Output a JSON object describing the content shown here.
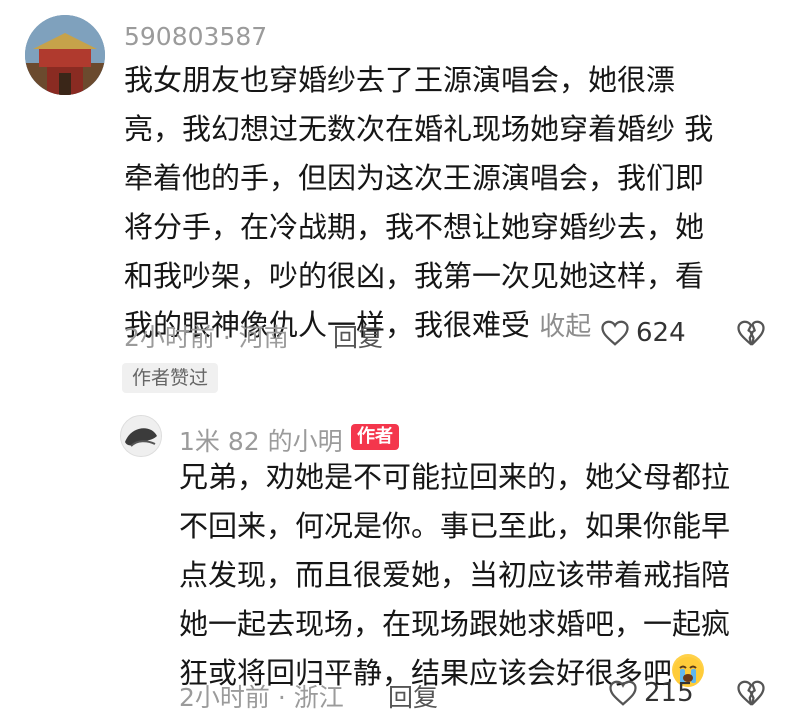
{
  "comment": {
    "username": "590803587",
    "lines": [
      "我女朋友也穿婚纱去了王源演唱会，她很漂",
      "亮，我幻想过无数次在婚礼现场她穿着婚纱 我",
      "牵着他的手，但因为这次王源演唱会，我们即",
      "将分手，在冷战期，我不想让她穿婚纱去，她",
      "和我吵架，吵的很凶，我第一次见她这样，看",
      "我的眼神像仇人一样，我很难受"
    ],
    "collapse_label": "收起",
    "meta": "2小时前 · 河南",
    "reply_label": "回复",
    "likes": "624",
    "author_liked_badge": "作者赞过"
  },
  "reply": {
    "username": "1米 82 的小明",
    "author_badge": "作者",
    "lines": [
      "兄弟，劝她是不可能拉回来的，她父母都拉",
      "不回来，何况是你。事已至此，如果你能早",
      "点发现，而且很爱她，当初应该带着戒指陪",
      "她一起去现场，在现场跟她求婚吧，一起疯",
      "狂或将回归平静，结果应该会好很多吧"
    ],
    "emoji": "crying-face-emoji",
    "meta": "2小时前 · 浙江",
    "reply_label": "回复",
    "likes": "215"
  },
  "colors": {
    "author_badge": "#f4364c",
    "meta_text": "#9b9b9b"
  }
}
